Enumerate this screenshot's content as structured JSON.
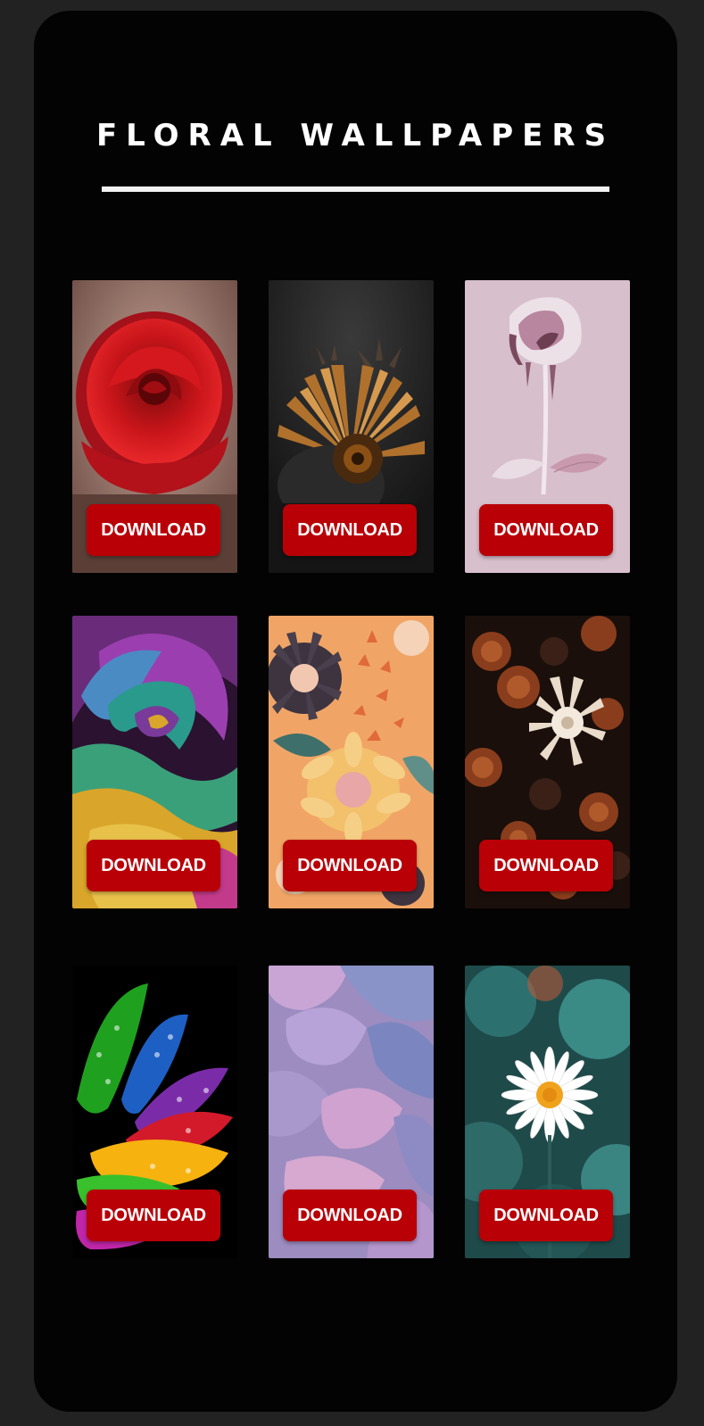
{
  "page": {
    "title": "FLORAL WALLPAPERS"
  },
  "wallpapers": [
    {
      "subject": "red rose",
      "download_label": "DOWNLOAD"
    },
    {
      "subject": "bronze gerbera daisy",
      "download_label": "DOWNLOAD"
    },
    {
      "subject": "pale pink dripping rose",
      "download_label": "DOWNLOAD"
    },
    {
      "subject": "rainbow rose",
      "download_label": "DOWNLOAD"
    },
    {
      "subject": "paper craft flowers",
      "download_label": "DOWNLOAD"
    },
    {
      "subject": "dark copper flowers",
      "download_label": "DOWNLOAD"
    },
    {
      "subject": "rainbow petals with dew drops",
      "download_label": "DOWNLOAD"
    },
    {
      "subject": "lilac hydrangea petals",
      "download_label": "DOWNLOAD"
    },
    {
      "subject": "white daisy",
      "download_label": "DOWNLOAD"
    }
  ],
  "colors": {
    "background": "#222222",
    "phone": "#030303",
    "title": "#ffffff",
    "download_button": "#b90007",
    "download_text": "#ffffff"
  }
}
